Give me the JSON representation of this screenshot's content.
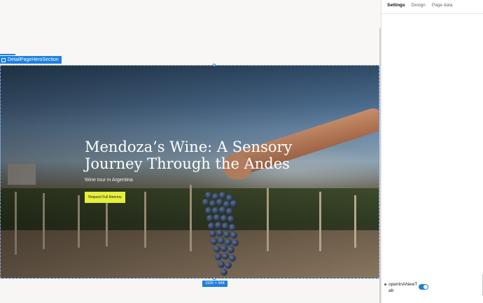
{
  "canvas": {
    "section_label": "DetailPageHeroSection",
    "size_badge": "1920 × 948"
  },
  "hero": {
    "title": "Mendoza’s Wine: A Sensory Journey Through the Andes",
    "subtitle": "Wine tour in Argentina",
    "button_label": "Request Full Itinerary"
  },
  "panel": {
    "tabs": [
      {
        "label": "Settings",
        "active": true
      },
      {
        "label": "Design",
        "active": false
      },
      {
        "label": "Page data",
        "active": false
      }
    ],
    "properties": [
      {
        "label": "openInANewTab",
        "enabled": true
      }
    ]
  },
  "colors": {
    "accent": "#1f7fe0",
    "button": "#e6ef3a"
  }
}
